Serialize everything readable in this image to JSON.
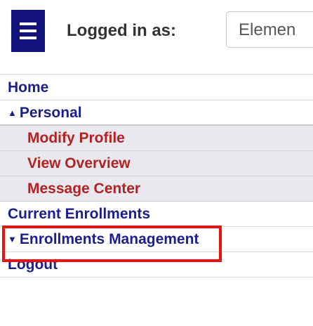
{
  "header": {
    "menu_icon": "hamburger-menu-icon",
    "logged_in_label": "Logged in as:",
    "selected_user": "Elemen",
    "menu_color": "#11127a"
  },
  "nav": {
    "items": [
      {
        "label": "Home",
        "type": "top"
      },
      {
        "label": "Personal",
        "type": "top",
        "expanded": true,
        "arrow": "▲"
      },
      {
        "label": "Modify Profile",
        "type": "sub"
      },
      {
        "label": "View Overview",
        "type": "sub"
      },
      {
        "label": "Message Center",
        "type": "sub"
      },
      {
        "label": "Current Enrollments",
        "type": "top",
        "highlighted": true
      },
      {
        "label": "Enrollments Management",
        "type": "top",
        "expanded": false,
        "arrow": "▼"
      },
      {
        "label": "Logout",
        "type": "top"
      }
    ]
  },
  "colors": {
    "top_link": "#1b1f8c",
    "sub_link": "#b22222",
    "sub_bg": "#e8e8ee",
    "highlight": "#ee1111"
  }
}
